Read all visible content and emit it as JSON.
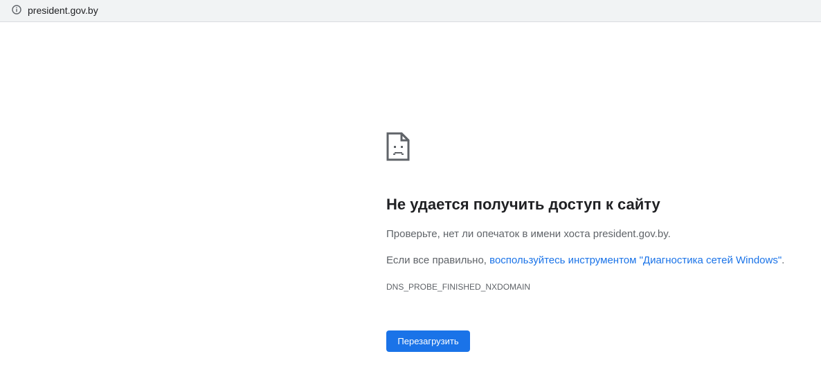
{
  "address_bar": {
    "url": "president.gov.by",
    "icon": "info-icon"
  },
  "error": {
    "icon": "sad-document-icon",
    "title": "Не удается получить доступ к сайту",
    "hint_typo": "Проверьте, нет ли опечаток в имени хоста president.gov.by.",
    "hint_prefix": "Если все правильно, ",
    "hint_link": "воспользуйтесь инструментом \"Диагностика сетей Windows\"",
    "hint_suffix": ".",
    "code": "DNS_PROBE_FINISHED_NXDOMAIN",
    "reload_label": "Перезагрузить"
  },
  "colors": {
    "accent": "#1a73e8",
    "title": "#202124",
    "text": "#5f6368",
    "toolbar": "#f1f3f4"
  }
}
